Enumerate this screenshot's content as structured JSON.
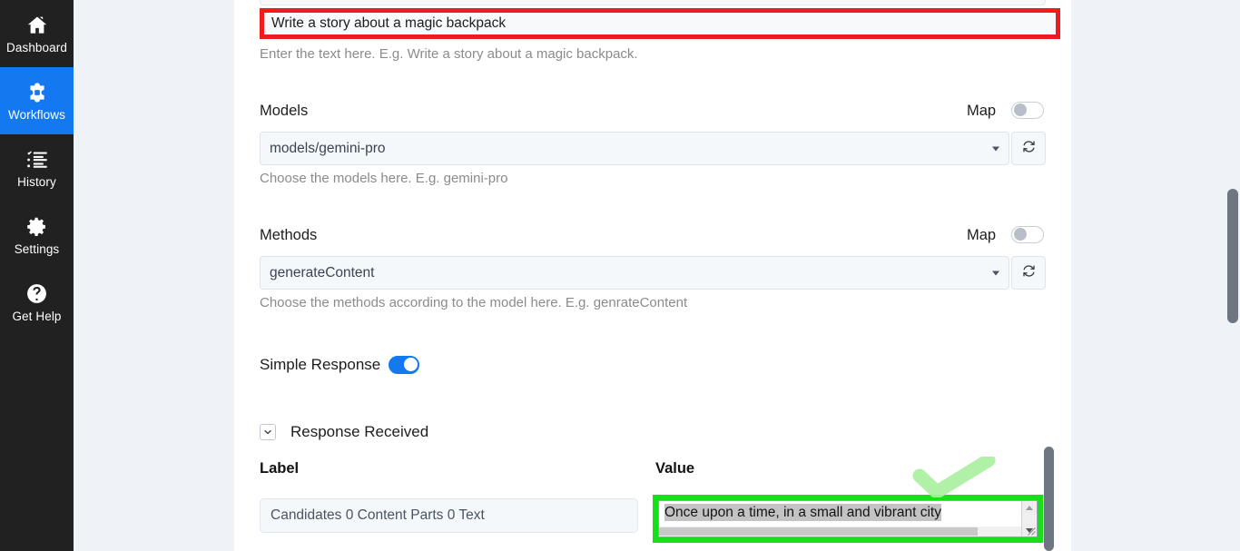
{
  "sidebar": {
    "items": [
      {
        "label": "Dashboard",
        "icon": "home-icon",
        "active": false
      },
      {
        "label": "Workflows",
        "icon": "workflows-puzzle-icon",
        "active": true
      },
      {
        "label": "History",
        "icon": "history-list-icon",
        "active": false
      },
      {
        "label": "Settings",
        "icon": "gear-icon",
        "active": false
      },
      {
        "label": "Get Help",
        "icon": "question-circle-icon",
        "active": false
      }
    ],
    "active_color": "#1478f0",
    "background_color": "#212121"
  },
  "form": {
    "prompt": {
      "value": "Write a story about a magic backpack",
      "placeholder": "Write a story about a magic backpack",
      "helper": "Enter the text here. E.g. Write a story about a magic backpack.",
      "highlight_color": "#ee1c1c"
    },
    "models": {
      "label": "Models",
      "map_label": "Map",
      "map_enabled": false,
      "selected": "models/gemini-pro",
      "helper": "Choose the models here. E.g. gemini-pro",
      "refresh_icon": "refresh-icon"
    },
    "methods": {
      "label": "Methods",
      "map_label": "Map",
      "map_enabled": false,
      "selected": "generateContent",
      "helper": "Choose the methods according to the model here. E.g. genrateContent",
      "refresh_icon": "refresh-icon"
    },
    "simple_response": {
      "label": "Simple Response",
      "enabled": true,
      "on_color": "#1478f0"
    }
  },
  "response_section": {
    "title": "Response Received",
    "collapse_icon": "chevron-down-icon",
    "columns": {
      "label": "Label",
      "value": "Value"
    },
    "rows": [
      {
        "label": "Candidates 0 Content Parts 0 Text",
        "value": "Once upon a time, in a small and vibrant city",
        "value_highlight_color": "#18e018",
        "value_selected": true
      }
    ]
  },
  "annotations": {
    "check_mark": "green-check-annotation"
  }
}
